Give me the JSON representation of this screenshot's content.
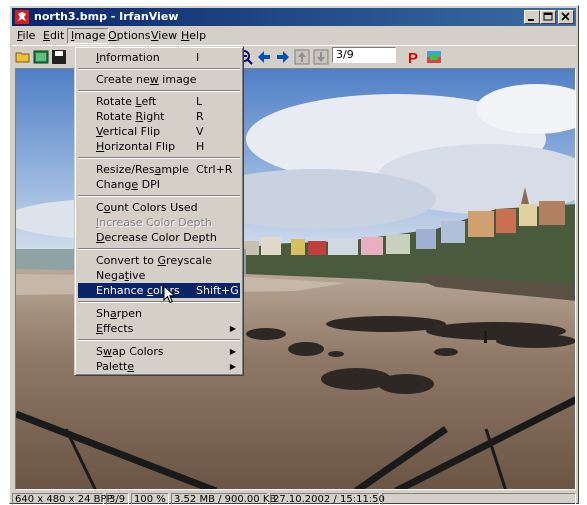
{
  "window": {
    "title": "north3.bmp - IrfanView",
    "controls": [
      "minimize-button",
      "maximize-button",
      "close-button"
    ]
  },
  "menubar": {
    "items": [
      {
        "label": "File",
        "accel": "F",
        "rest": "ile"
      },
      {
        "label": "Edit",
        "accel": "E",
        "rest": "dit"
      },
      {
        "label": "Image",
        "accel": "I",
        "rest": "mage",
        "active": true
      },
      {
        "label": "Options",
        "accel": "O",
        "rest": "ptions"
      },
      {
        "label": "View",
        "accel": "V",
        "rest": "iew"
      },
      {
        "label": "Help",
        "accel": "H",
        "rest": "elp"
      }
    ]
  },
  "toolbar": {
    "nav_field": "3/9",
    "icons": [
      "open-folder-icon",
      "thumbnails-icon",
      "save-icon",
      "zoom-out-icon",
      "back-arrow-icon",
      "forward-arrow-icon",
      "first-icon",
      "last-icon",
      "paint-icon",
      "settings-icon"
    ]
  },
  "image_menu": {
    "items": [
      {
        "pre": "",
        "u": "I",
        "post": "nformation",
        "shortcut": "I"
      },
      {
        "pre": "Create ne",
        "u": "w",
        "post": " image",
        "shortcut": ""
      },
      {
        "pre": "Rotate ",
        "u": "L",
        "post": "eft",
        "shortcut": "L"
      },
      {
        "pre": "Rotate ",
        "u": "R",
        "post": "ight",
        "shortcut": "R"
      },
      {
        "pre": "",
        "u": "V",
        "post": "ertical Flip",
        "shortcut": "V"
      },
      {
        "pre": "",
        "u": "H",
        "post": "orizontal Flip",
        "shortcut": "H"
      },
      {
        "pre": "Resize/Res",
        "u": "a",
        "post": "mple",
        "shortcut": "Ctrl+R"
      },
      {
        "pre": "Chang",
        "u": "e",
        "post": " DPI",
        "shortcut": ""
      },
      {
        "pre": "C",
        "u": "o",
        "post": "unt Colors Used",
        "shortcut": ""
      },
      {
        "pre": "",
        "u": "I",
        "post": "ncrease Color Depth",
        "shortcut": "",
        "disabled": true
      },
      {
        "pre": "",
        "u": "D",
        "post": "ecrease Color Depth",
        "shortcut": ""
      },
      {
        "pre": "Convert to ",
        "u": "G",
        "post": "reyscale",
        "shortcut": ""
      },
      {
        "pre": "Nega",
        "u": "t",
        "post": "ive",
        "shortcut": ""
      },
      {
        "pre": "Enhance ",
        "u": "c",
        "post": "olors",
        "shortcut": "Shift+G",
        "highlighted": true
      },
      {
        "pre": "Sh",
        "u": "a",
        "post": "rpen",
        "shortcut": ""
      },
      {
        "pre": "",
        "u": "E",
        "post": "ffects",
        "shortcut": "",
        "submenu": true
      },
      {
        "pre": "S",
        "u": "w",
        "post": "ap Colors",
        "shortcut": "",
        "submenu": true
      },
      {
        "pre": "Palett",
        "u": "e",
        "post": "",
        "shortcut": "",
        "submenu": true
      }
    ]
  },
  "statusbar": {
    "cells": [
      "640 x 480 x 24 BPP",
      "3/9",
      "100 %",
      "3.52 MB / 900.00 KB",
      "27.10.2002 / 15:11:50"
    ]
  },
  "colors": {
    "title_bar": "#0a246a",
    "menu_highlight": "#0a246a",
    "face": "#d4d0c8"
  }
}
